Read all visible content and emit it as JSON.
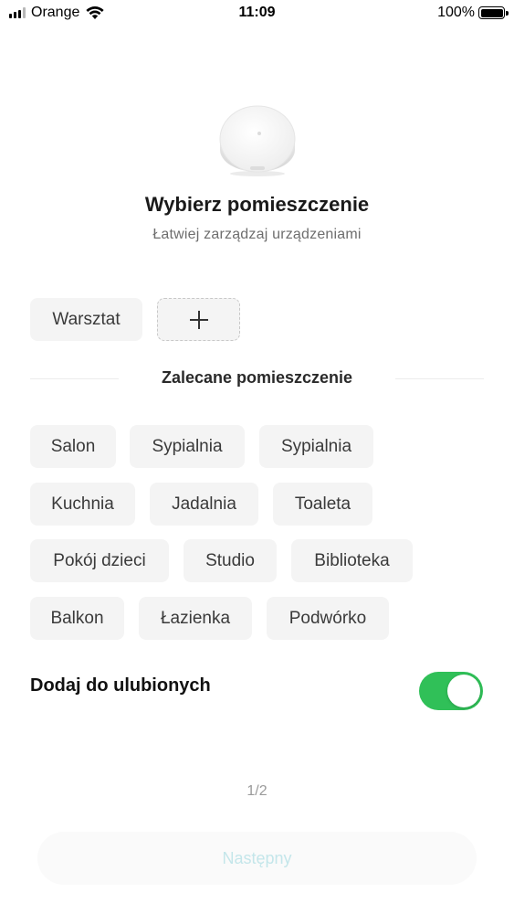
{
  "status_bar": {
    "carrier": "Orange",
    "time": "11:09",
    "battery": "100%"
  },
  "header": {
    "title": "Wybierz pomieszczenie",
    "subtitle": "Łatwiej zarządzaj urządzeniami"
  },
  "custom_rooms": [
    "Warsztat"
  ],
  "add_room_symbol": "+",
  "recommended": {
    "label": "Zalecane pomieszczenie",
    "rooms": [
      "Salon",
      "Sypialnia",
      "Sypialnia",
      "Kuchnia",
      "Jadalnia",
      "Toaleta",
      "Pokój dzieci",
      "Studio",
      "Biblioteka",
      "Balkon",
      "Łazienka",
      "Podwórko"
    ]
  },
  "favorites": {
    "label": "Dodaj do ulubionych",
    "enabled": true,
    "toggle_color": "#30c058"
  },
  "pager": "1/2",
  "next_button": "Następny",
  "icons": {
    "signal": "signal-bars-icon",
    "wifi": "wifi-icon",
    "battery": "battery-icon",
    "add": "plus-icon",
    "device": "zigbee-hub-device"
  }
}
